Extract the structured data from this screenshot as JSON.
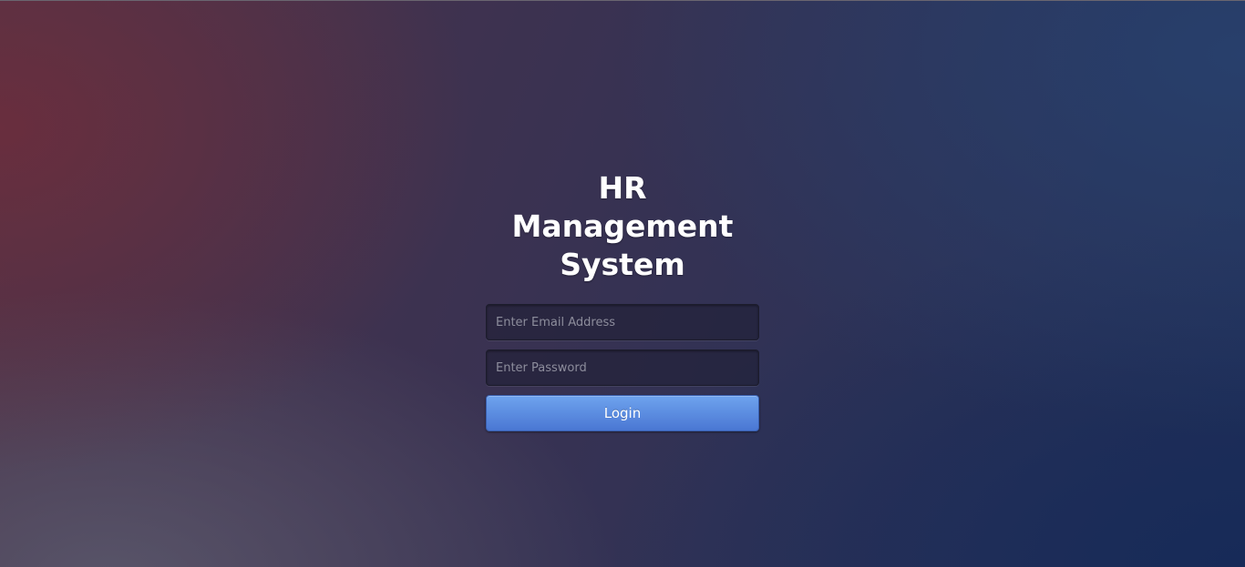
{
  "page": {
    "title_line1": "HR Management",
    "title_line2": "System"
  },
  "form": {
    "email_placeholder": "Enter Email Address",
    "email_value": "",
    "password_placeholder": "Enter Password",
    "password_value": "",
    "login_label": "Login"
  },
  "colors": {
    "button_top": "#6ea3ee",
    "button_bottom": "#4a77d3",
    "title_text": "#ffffff"
  }
}
